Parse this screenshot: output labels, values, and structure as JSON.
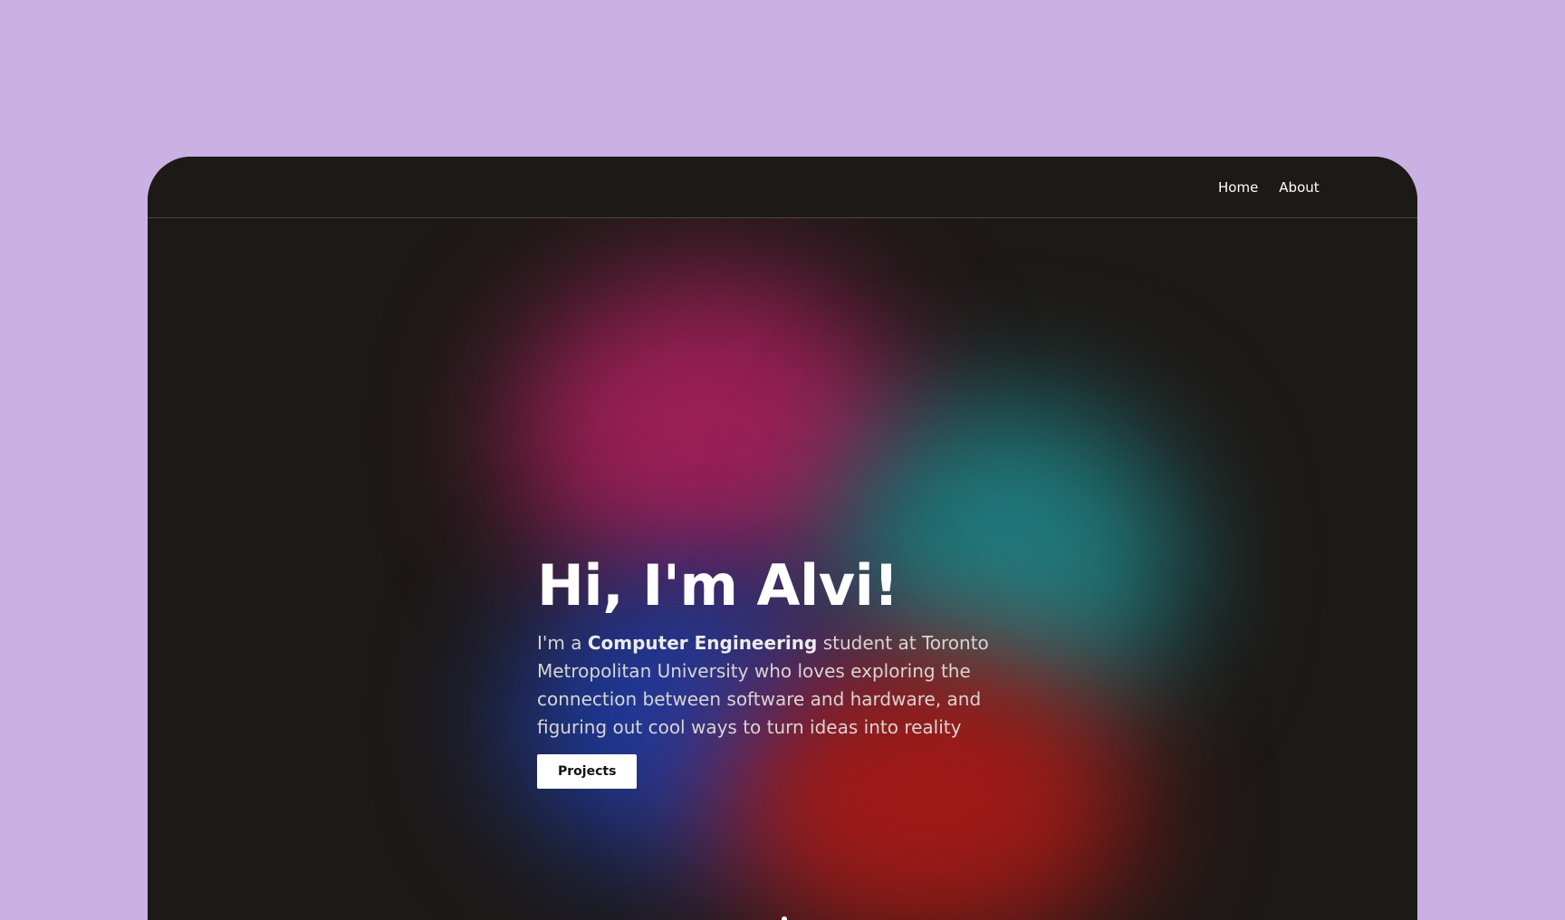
{
  "colors": {
    "page_background": "#cbb0e3",
    "site_background": "#1d1917",
    "nav_text": "#ffffff",
    "nav_border": "#4a4745",
    "title_text": "#ffffff",
    "body_text": "#d8d4d2",
    "button_background": "#ffffff",
    "button_text": "#111111",
    "blob_magenta": "#9b1f55",
    "blob_teal": "#1f7a7d",
    "blob_blue": "#1e3a9e",
    "blob_red": "#a01a17"
  },
  "nav": {
    "links": [
      {
        "label": "Home",
        "icon": null
      },
      {
        "label": "About",
        "icon": null
      }
    ]
  },
  "hero": {
    "title": "Hi, I'm Alvi!",
    "description_prefix": "I'm a ",
    "description_highlight": "Computer Engineering",
    "description_suffix": " student at Toronto Metropolitan University who loves exploring the connection between software and hardware, and figuring out cool ways to turn ideas into reality",
    "button_label": "Projects"
  }
}
